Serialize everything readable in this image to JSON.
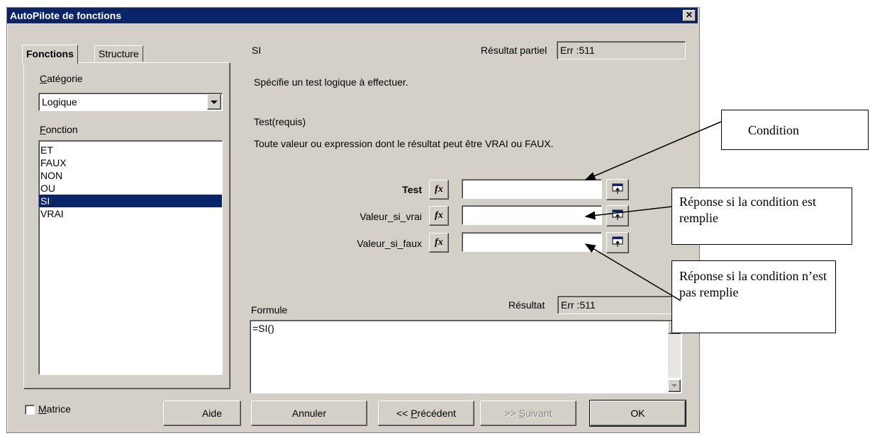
{
  "window": {
    "title": "AutoPilote de fonctions",
    "close_label": "✕"
  },
  "tabs": {
    "functions": "Fonctions",
    "structure": "Structure"
  },
  "category": {
    "label_first": "C",
    "label_rest": "atégorie",
    "value": "Logique"
  },
  "function_list": {
    "label_first": "F",
    "label_rest": "onction",
    "items": [
      "ET",
      "FAUX",
      "NON",
      "OU",
      "SI",
      "VRAI"
    ],
    "selected": "SI"
  },
  "function_info": {
    "name": "SI",
    "partial_result_label": "Résultat partiel",
    "partial_result_value": "Err :511",
    "description": "Spécifie un test logique à effectuer.",
    "param_title": "Test(requis)",
    "param_description": "Toute valeur ou expression dont le résultat peut être VRAI ou FAUX."
  },
  "parameters": [
    {
      "label": "Test",
      "fx": "fx",
      "value": ""
    },
    {
      "label": "Valeur_si_vrai",
      "fx": "fx",
      "value": ""
    },
    {
      "label": "Valeur_si_faux",
      "fx": "fx",
      "value": ""
    }
  ],
  "formula": {
    "label": "Formule",
    "result_label": "Résultat",
    "result_value": "Err :511",
    "text": "=SI()"
  },
  "matrix": {
    "label_first": "M",
    "label_rest": "atrice",
    "checked": false
  },
  "buttons": {
    "help": "Aide",
    "cancel": "Annuler",
    "previous_prefix": "<< ",
    "previous_first": "P",
    "previous_rest": "récédent",
    "next_prefix": ">> ",
    "next_first": "S",
    "next_rest": "uivant",
    "ok": "OK"
  },
  "annotations": {
    "condition": "Condition",
    "if_true": "Réponse si la condition est remplie",
    "if_false": "Réponse si la condition n’est pas remplie"
  },
  "colors": {
    "titlebar": "#0a246a",
    "dialog": "#d4d0c8",
    "selection": "#0a246a"
  }
}
